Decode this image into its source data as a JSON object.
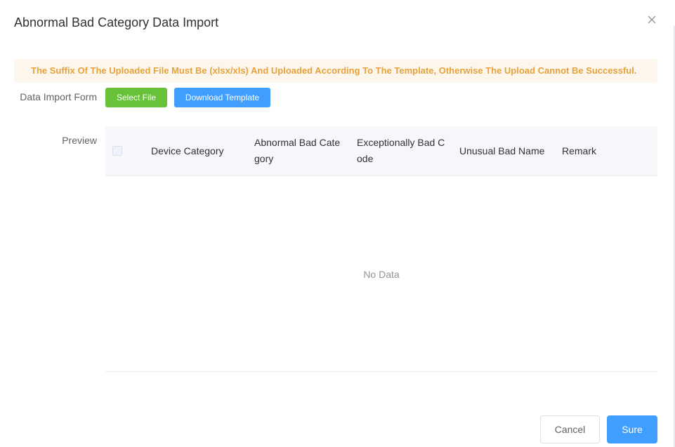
{
  "dialog": {
    "title": "Abnormal Bad Category Data Import",
    "close_icon": "close-icon"
  },
  "alert": {
    "message": "The Suffix Of The Uploaded File Must Be (xlsx/xls) And Uploaded According To The Template, Otherwise The Upload Cannot Be Successful.",
    "color": "#e6a23c",
    "background": "#fdf6ec"
  },
  "form": {
    "import_label": "Data Import Form",
    "preview_label": "Preview",
    "select_file_label": "Select File",
    "download_template_label": "Download Template"
  },
  "table": {
    "columns": [
      "Device Category",
      "Abnormal Bad Cate gory",
      "Exceptionally Bad C ode",
      "Unusual Bad Name",
      "Remark"
    ],
    "empty_text": "No Data"
  },
  "footer": {
    "cancel_label": "Cancel",
    "sure_label": "Sure"
  },
  "colors": {
    "primary": "#409eff",
    "success": "#67c23a"
  }
}
